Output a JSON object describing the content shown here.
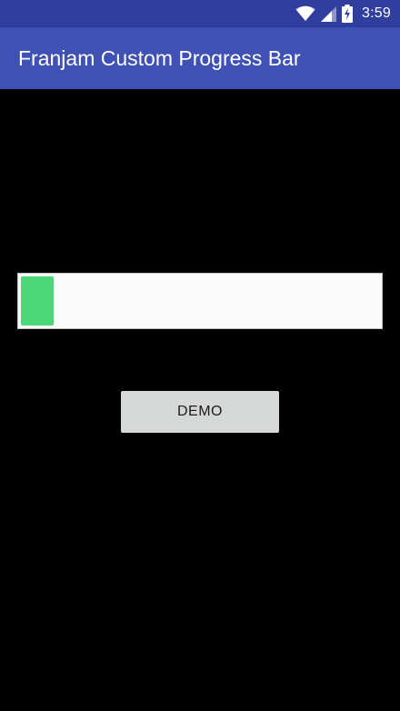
{
  "status_bar": {
    "time": "3:59",
    "icons": [
      "wifi-icon",
      "cell-signal-icon",
      "battery-charging-icon"
    ],
    "background": "#303f9f"
  },
  "app_bar": {
    "title": "Franjam Custom Progress Bar",
    "background": "#3f51b5"
  },
  "progress": {
    "fraction": 0.092,
    "fill_color": "#4cd879",
    "track_color": "#fafafa"
  },
  "demo_button": {
    "label": "DEMO",
    "background": "#d6d7d7"
  }
}
